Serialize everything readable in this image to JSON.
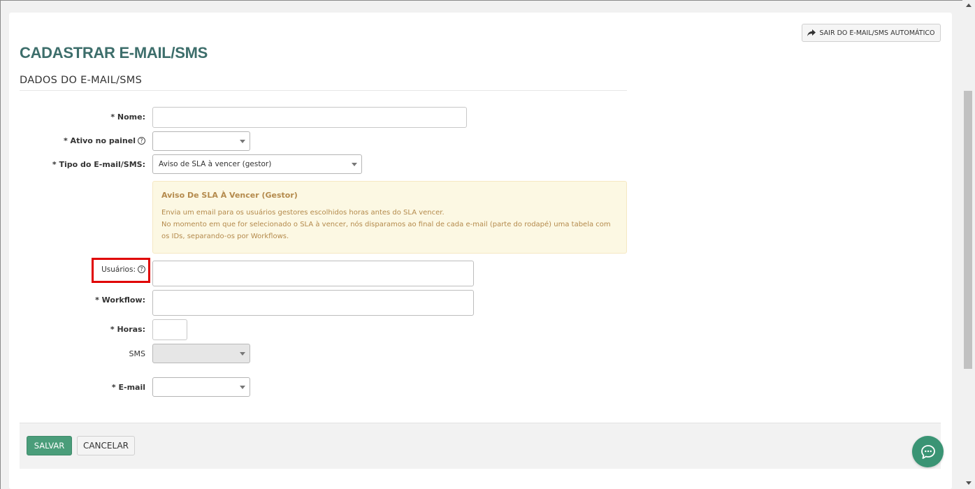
{
  "header": {
    "exit_button": "SAIR DO E-MAIL/SMS AUTOMÁTICO",
    "page_title": "CADASTRAR E-MAIL/SMS",
    "section_title": "DADOS DO E-MAIL/SMS"
  },
  "form": {
    "nome_label": "* Nome:",
    "nome_value": "",
    "ativo_label": "* Ativo no painel",
    "ativo_value": "",
    "tipo_label": "* Tipo do E-mail/SMS:",
    "tipo_value": "Aviso de SLA à vencer (gestor)",
    "usuarios_label": "Usuários:",
    "usuarios_value": "",
    "workflow_label": "* Workflow:",
    "workflow_value": "",
    "horas_label": "* Horas:",
    "horas_value": "",
    "sms_label": "SMS",
    "sms_value": "",
    "email_label": "* E-mail",
    "email_value": "",
    "help_symbol": "?"
  },
  "info": {
    "title": "Aviso De SLA À Vencer (Gestor)",
    "line1": "Envia um email para os usuários gestores escolhidos horas antes do SLA vencer.",
    "line2": "No momento em que for selecionado o SLA à vencer, nós disparamos ao final de cada e-mail (parte do rodapé) uma tabela com os IDs, separando-os por Workflows."
  },
  "footer": {
    "save_label": "SALVAR",
    "cancel_label": "CANCELAR"
  },
  "colors": {
    "title": "#3d6e6b",
    "save_button": "#4a9d7a",
    "chat_button": "#3a9474",
    "info_background": "#fcf8e3",
    "info_text": "#b48a4c",
    "highlight": "#e00000"
  },
  "icons": {
    "exit": "share-arrow-icon",
    "chat": "chat-bubble-icon",
    "help": "question-circle-icon"
  }
}
